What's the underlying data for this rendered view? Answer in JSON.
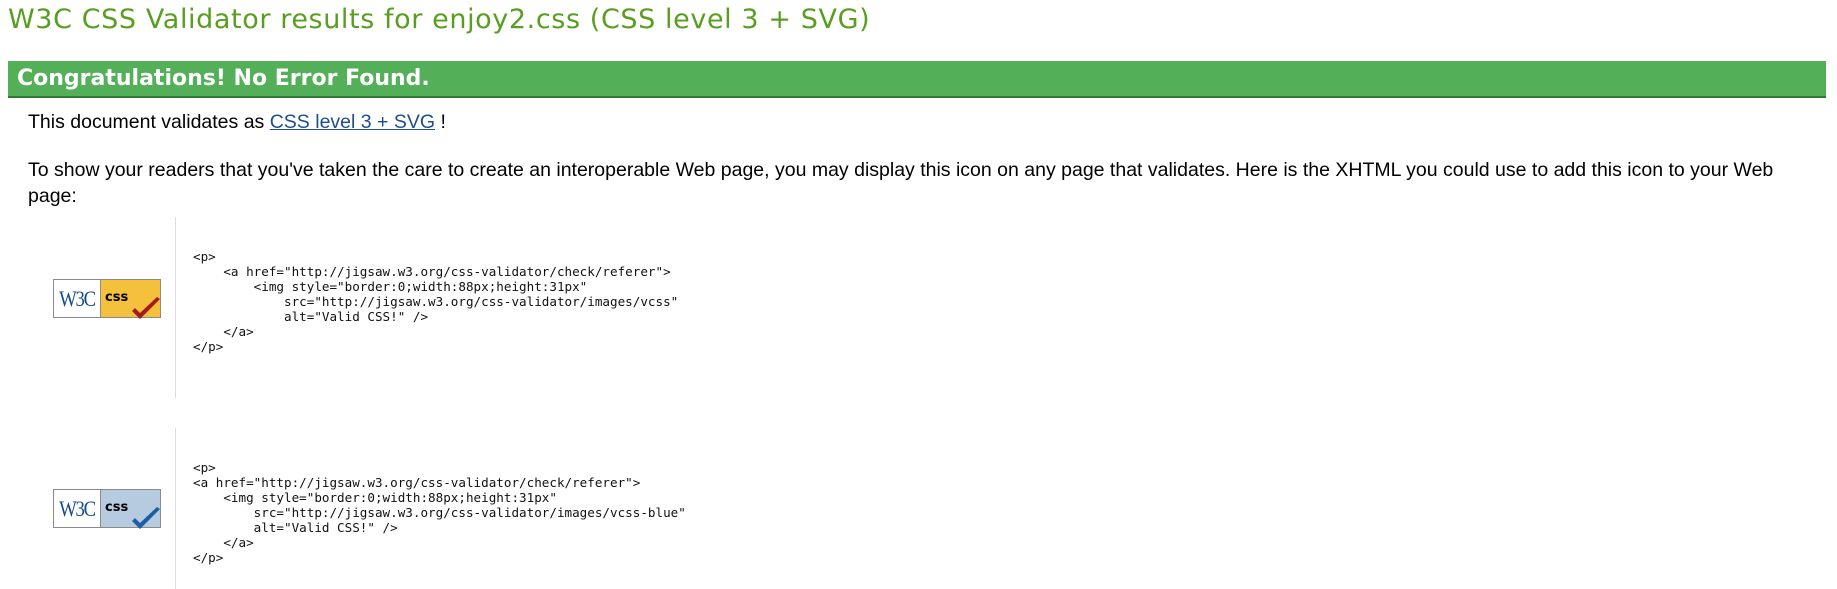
{
  "page": {
    "title": "W3C CSS Validator results for enjoy2.css (CSS level 3 + SVG)",
    "banner": "Congratulations! No Error Found.",
    "validates_prefix": "This document validates as",
    "validates_link": "CSS level 3 + SVG",
    "validates_suffix": "!",
    "instructions": "To show your readers that you've taken the care to create an interoperable Web page, you may display this icon on any page that validates. Here is the XHTML you could use to add this icon to your Web page:"
  },
  "badges": [
    {
      "w3c_label": "W3C",
      "css_label": "css",
      "css_bg": "#f5c13d",
      "check_color": "#a41b1b",
      "code": "<p>\n    <a href=\"http://jigsaw.w3.org/css-validator/check/referer\">\n        <img style=\"border:0;width:88px;height:31px\"\n            src=\"http://jigsaw.w3.org/css-validator/images/vcss\"\n            alt=\"Valid CSS!\" />\n    </a>\n</p>"
    },
    {
      "w3c_label": "W3C",
      "css_label": "css",
      "css_bg": "#b7cbe0",
      "check_color": "#1b5ea6",
      "code": "<p>\n<a href=\"http://jigsaw.w3.org/css-validator/check/referer\">\n    <img style=\"border:0;width:88px;height:31px\"\n        src=\"http://jigsaw.w3.org/css-validator/images/vcss-blue\"\n        alt=\"Valid CSS!\" />\n    </a>\n</p>"
    }
  ],
  "colors": {
    "title": "#599e20",
    "banner_bg": "#54b058",
    "link": "#1d4f8c"
  }
}
